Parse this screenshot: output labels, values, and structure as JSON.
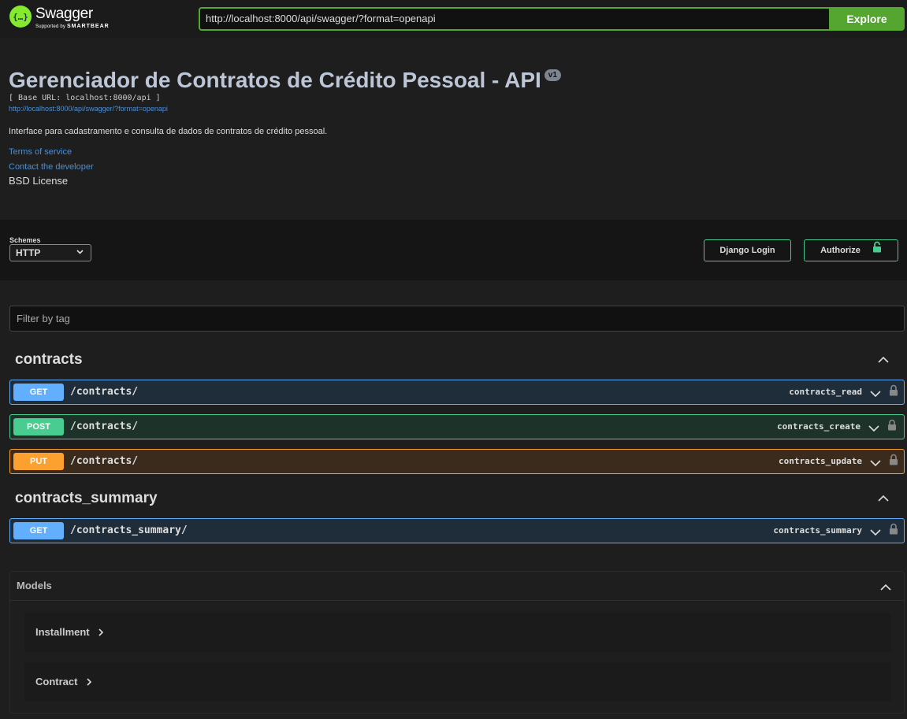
{
  "topbar": {
    "logo_glyph": "{…}",
    "logo_name": "Swagger",
    "logo_supported": "Supported by",
    "logo_company": "SMARTBEAR",
    "url_value": "http://localhost:8000/api/swagger/?format=openapi",
    "explore_label": "Explore",
    "accent_color": "#85ea2d"
  },
  "info": {
    "title": "Gerenciador de Contratos de Crédito Pessoal - API",
    "version": "v1",
    "base_url": "[ Base URL: localhost:8000/api ]",
    "spec_url": "http://localhost:8000/api/swagger/?format=openapi",
    "description": "Interface para cadastramento e consulta de dados de contratos de crédito pessoal.",
    "terms_label": "Terms of service",
    "contact_label": "Contact the developer",
    "license_label": "BSD License"
  },
  "schemes": {
    "label": "Schemes",
    "selected": "HTTP",
    "django_login_label": "Django Login",
    "authorize_label": "Authorize"
  },
  "filter": {
    "placeholder": "Filter by tag"
  },
  "tags": [
    {
      "name": "contracts",
      "operations": [
        {
          "method": "GET",
          "path": "/contracts/",
          "operation_id": "contracts_read"
        },
        {
          "method": "POST",
          "path": "/contracts/",
          "operation_id": "contracts_create"
        },
        {
          "method": "PUT",
          "path": "/contracts/",
          "operation_id": "contracts_update"
        }
      ]
    },
    {
      "name": "contracts_summary",
      "operations": [
        {
          "method": "GET",
          "path": "/contracts_summary/",
          "operation_id": "contracts_summary"
        }
      ]
    }
  ],
  "models": {
    "title": "Models",
    "items": [
      "Installment",
      "Contract"
    ]
  },
  "colors": {
    "get": "#61affe",
    "post": "#49cc90",
    "put": "#fca130",
    "explore": "#55a630"
  },
  "icons": {
    "expand": "chevron-down-icon",
    "collapse": "chevron-up-icon",
    "lock": "lock-icon",
    "model_expand": "chevron-right-icon"
  }
}
